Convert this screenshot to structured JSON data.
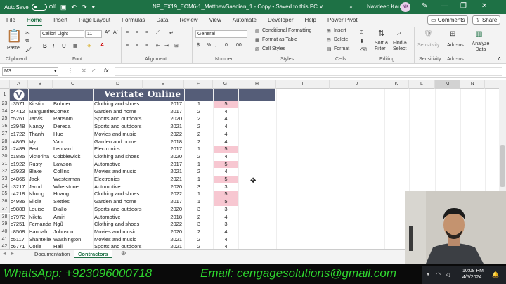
{
  "titlebar": {
    "autosave_label": "AutoSave",
    "autosave_state": "Off",
    "doc_title": "NP_EX19_EOM6-1_MatthewSaadian_1 - Copy • Saved to this PC ∨",
    "user_name": "Navdeep Kaur",
    "avatar_initials": "NK"
  },
  "menu": [
    "File",
    "Home",
    "Insert",
    "Page Layout",
    "Formulas",
    "Data",
    "Review",
    "View",
    "Automate",
    "Developer",
    "Help",
    "Power Pivot"
  ],
  "menu_active": "Home",
  "comments_label": "Comments",
  "share_label": "Share",
  "ribbon": {
    "paste_label": "Paste",
    "clipboard_label": "Clipboard",
    "font_name": "Calibri Light",
    "font_size": "11",
    "font_group_label": "Font",
    "alignment_label": "Alignment",
    "number_format": "General",
    "number_label": "Number",
    "conditional_formatting": "Conditional Formatting",
    "format_as_table": "Format as Table",
    "cell_styles": "Cell Styles",
    "styles_label": "Styles",
    "insert": "Insert",
    "delete": "Delete",
    "format": "Format",
    "cells_label": "Cells",
    "sort_filter": "Sort & Filter",
    "find_select": "Find & Select",
    "editing_label": "Editing",
    "sensitivity": "Sensitivity",
    "sensitivity_label": "Sensitivity",
    "addins": "Add-ins",
    "addins_label": "Add-ins",
    "analyze_data": "Analyze Data",
    "bold": "B",
    "italic": "I",
    "underline": "U"
  },
  "formula_bar": {
    "name_box": "M3",
    "fx": "fx",
    "formula": ""
  },
  "columns": [
    "A",
    "B",
    "C",
    "D",
    "E",
    "F",
    "G",
    "H",
    "I",
    "J",
    "K",
    "L",
    "M",
    "N"
  ],
  "selected_column": "M",
  "banner_title": "Veritate Online",
  "rows": [
    {
      "n": "1",
      "a": "",
      "b": "",
      "c": "",
      "d": "",
      "e": "",
      "f": "",
      "g": "",
      "banner": true
    },
    {
      "n": "23",
      "a": "c3571",
      "b": "Kirstin",
      "c": "Bohner",
      "d": "Clothing and shoes",
      "e": "2017",
      "f": "1",
      "g": "5",
      "hl": true
    },
    {
      "n": "24",
      "a": "c4412",
      "b": "Marguerite",
      "c": "Cortez",
      "d": "Garden and home",
      "e": "2017",
      "f": "2",
      "g": "4"
    },
    {
      "n": "25",
      "a": "c5261",
      "b": "Jarvis",
      "c": "Ransom",
      "d": "Sports and outdoors",
      "e": "2020",
      "f": "2",
      "g": "4"
    },
    {
      "n": "26",
      "a": "c3948",
      "b": "Nancy",
      "c": "Dereda",
      "d": "Sports and outdoors",
      "e": "2021",
      "f": "2",
      "g": "4"
    },
    {
      "n": "27",
      "a": "c1722",
      "b": "Thanh",
      "c": "Hue",
      "d": "Movies and music",
      "e": "2022",
      "f": "2",
      "g": "4"
    },
    {
      "n": "28",
      "a": "c4865",
      "b": "My",
      "c": "Van",
      "d": "Garden and home",
      "e": "2018",
      "f": "2",
      "g": "4"
    },
    {
      "n": "29",
      "a": "c2489",
      "b": "Bert",
      "c": "Leonard",
      "d": "Electronics",
      "e": "2017",
      "f": "1",
      "g": "5",
      "hl": true
    },
    {
      "n": "30",
      "a": "c1885",
      "b": "Victorina",
      "c": "Cobblewick",
      "d": "Clothing and shoes",
      "e": "2020",
      "f": "2",
      "g": "4"
    },
    {
      "n": "31",
      "a": "c1922",
      "b": "Rusty",
      "c": "Lawson",
      "d": "Automotive",
      "e": "2017",
      "f": "1",
      "g": "5",
      "hl": true
    },
    {
      "n": "32",
      "a": "c3923",
      "b": "Blake",
      "c": "Collins",
      "d": "Movies and music",
      "e": "2021",
      "f": "2",
      "g": "4"
    },
    {
      "n": "33",
      "a": "c4866",
      "b": "Jack",
      "c": "Westerman",
      "d": "Electronics",
      "e": "2021",
      "f": "1",
      "g": "5",
      "hl": true
    },
    {
      "n": "34",
      "a": "c3217",
      "b": "Jarod",
      "c": "Whetstone",
      "d": "Automotive",
      "e": "2020",
      "f": "3",
      "g": "3"
    },
    {
      "n": "35",
      "a": "c4218",
      "b": "Nhung",
      "c": "Hoang",
      "d": "Clothing and shoes",
      "e": "2022",
      "f": "1",
      "g": "5",
      "hl": true
    },
    {
      "n": "36",
      "a": "c4986",
      "b": "Elicia",
      "c": "Settles",
      "d": "Garden and home",
      "e": "2017",
      "f": "1",
      "g": "5",
      "hl": true
    },
    {
      "n": "37",
      "a": "c9888",
      "b": "Louise",
      "c": "Diallo",
      "d": "Sports and outdoors",
      "e": "2020",
      "f": "3",
      "g": "3"
    },
    {
      "n": "38",
      "a": "c7972",
      "b": "Nikita",
      "c": "Amiri",
      "d": "Automotive",
      "e": "2018",
      "f": "2",
      "g": "4"
    },
    {
      "n": "39",
      "a": "c7251",
      "b": "Fernanda",
      "c": "Ngũ",
      "d": "Clothing and shoes",
      "e": "2022",
      "f": "3",
      "g": "3"
    },
    {
      "n": "40",
      "a": "c8508",
      "b": "Hannah",
      "c": "Johnson",
      "d": "Movies and music",
      "e": "2020",
      "f": "2",
      "g": "4"
    },
    {
      "n": "41",
      "a": "c5117",
      "b": "Shantelle",
      "c": "Washington",
      "d": "Movies and music",
      "e": "2021",
      "f": "2",
      "g": "4"
    },
    {
      "n": "42",
      "a": "c6771",
      "b": "Corie",
      "c": "Hall",
      "d": "Sports and outdoors",
      "e": "2021",
      "f": "2",
      "g": "4"
    }
  ],
  "sheets": [
    "Documentation",
    "Contractors"
  ],
  "active_sheet": "Contractors",
  "promo": {
    "whatsapp": "WhatsApp: +923096000718",
    "email": "Email: cengagesolutions@gmail.com"
  },
  "clock": {
    "time": "10:08 PM",
    "date": "4/5/2024"
  },
  "colors": {
    "excel_green": "#1e7145",
    "banner": "#555d78",
    "highlight": "#f7c7d1",
    "promo_text": "#2ed52e"
  }
}
